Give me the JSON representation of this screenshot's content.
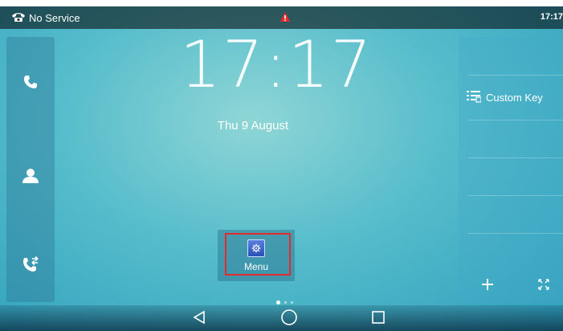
{
  "status_bar": {
    "signal_text": "No Service",
    "time": "17:17",
    "phone_icon": "phone-handset-icon",
    "alert_icon": "warning-icon"
  },
  "left_panel": {
    "buttons": [
      {
        "icon": "phone-icon"
      },
      {
        "icon": "contacts-icon"
      },
      {
        "icon": "call-log-icon"
      }
    ]
  },
  "home": {
    "clock": "17:17",
    "date": "Thu 9 August"
  },
  "menu": {
    "label": "Menu",
    "icon": "settings-icon",
    "highlight_color": "#e32b2b"
  },
  "right_panel": {
    "custom_key_label": "Custom Key",
    "custom_key_icon": "list-icon",
    "add_icon": "plus-icon",
    "expand_icon": "expand-icon"
  },
  "nav": {
    "back_icon": "back-triangle-icon",
    "home_icon": "home-circle-icon",
    "recent_icon": "recent-square-icon"
  },
  "page_indicator": {
    "pages": 3,
    "active": 1
  }
}
